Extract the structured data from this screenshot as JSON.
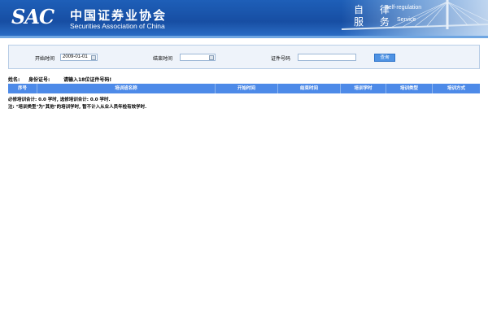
{
  "header": {
    "logo_text": "SAC",
    "org_name_cn": "中国证券业协会",
    "org_name_en": "Securities Association of China",
    "self_reg_cn_1": "自 律",
    "self_reg_cn_2": "服 务",
    "self_reg_en_1": "Self-regulation",
    "self_reg_en_2": "Service"
  },
  "search": {
    "start_label": "开始时间",
    "start_value": "2009-01-01",
    "end_label": "结束时间",
    "end_value": "",
    "cert_label": "证件号码",
    "cert_value": "",
    "query_button": "查询"
  },
  "info": {
    "name_label": "姓名:",
    "id_label": "身份证号:",
    "id_prompt": "请输入18位证件号码!"
  },
  "table": {
    "columns": [
      "序号",
      "培训班名称",
      "开始时间",
      "结束时间",
      "培训学时",
      "培训类型",
      "培训方式"
    ]
  },
  "summary": {
    "text": "必修培训合计: 0.0 学时, 选修培训合计: 0.0 学时."
  },
  "note": {
    "text": "注: \"培训类型\"为\"其他\"的培训学时, 暂不计入从业人员年检有效学时."
  },
  "colors": {
    "header_blue": "#1e5fb8",
    "table_header_blue": "#4d8ae8",
    "button_blue": "#4e92e3"
  }
}
